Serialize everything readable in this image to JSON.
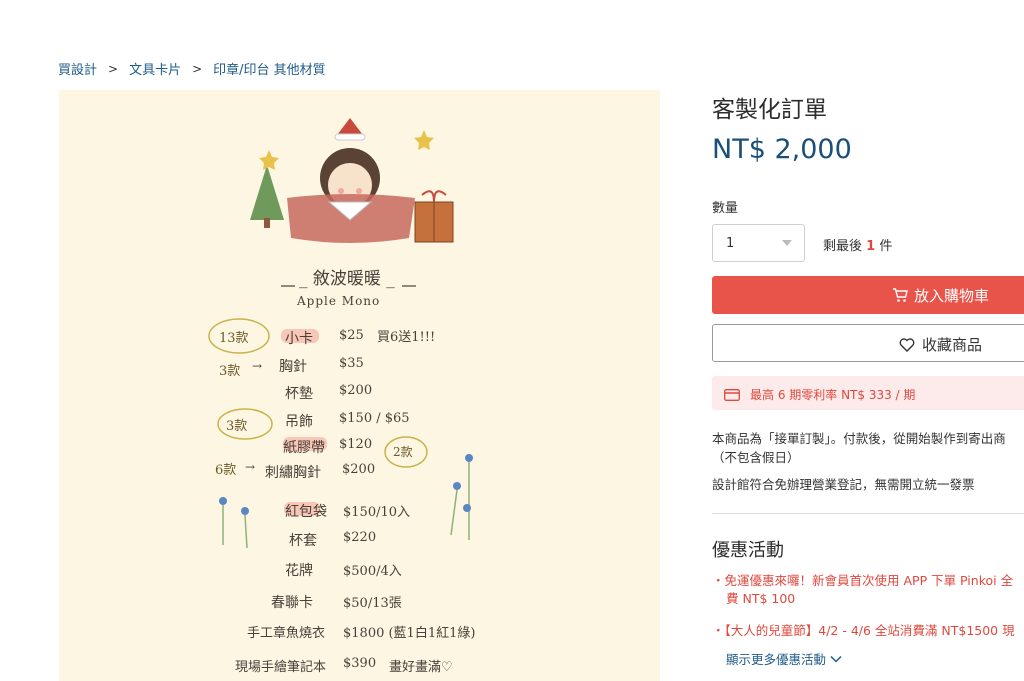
{
  "breadcrumb": {
    "items": [
      "買設計",
      "文具卡片",
      "印章/印台 其他材質"
    ]
  },
  "product_image": {
    "handwriting": {
      "heading": "_ 敘波暖暖 _",
      "subheading": "Apple Mono",
      "notes": {
        "n13": "13款",
        "n3a": "3款",
        "n3b": "3款",
        "n6": "6款",
        "n2": "2款",
        "arrow1": "→",
        "arrow2": "→"
      },
      "items": [
        {
          "name": "小卡",
          "price": "$25",
          "note": "買6送1!!!"
        },
        {
          "name": "胸針",
          "price": "$35",
          "note": ""
        },
        {
          "name": "杯墊",
          "price": "$200",
          "note": ""
        },
        {
          "name": "吊飾",
          "price": "$150 / $65",
          "note": ""
        },
        {
          "name": "紙膠帶",
          "price": "$120",
          "note": ""
        },
        {
          "name": "刺繡胸針",
          "price": "$200",
          "note": ""
        },
        {
          "name": "紅包袋",
          "price": "$150/10入",
          "note": ""
        },
        {
          "name": "杯套",
          "price": "$220",
          "note": ""
        },
        {
          "name": "花牌",
          "price": "$500/4入",
          "note": ""
        },
        {
          "name": "春聯卡",
          "price": "$50/13張",
          "note": ""
        },
        {
          "name": "手工章魚燒衣",
          "price": "$1800 (藍1白1紅1綠)",
          "note": ""
        },
        {
          "name": "現場手繪筆記本",
          "price": "$390",
          "note": "畫好畫滿♡"
        }
      ]
    }
  },
  "product": {
    "title": "客製化訂單",
    "price": "NT$ 2,000",
    "quantity_label": "數量",
    "quantity_value": "1",
    "stock_prefix": "剩最後",
    "stock_count": "1",
    "stock_suffix": "件",
    "add_to_cart": "放入購物車",
    "favorite": "收藏商品",
    "installment": "最高 6 期零利率 NT$ 333 / 期",
    "desc_line1": "本商品為「接單訂製」。付款後，從開始製作到寄出商",
    "desc_line2": "（不包含假日）",
    "desc_line3": "設計館符合免辦理營業登記，無需開立統一發票"
  },
  "promotions": {
    "title": "優惠活動",
    "items": [
      {
        "line1": "・免運優惠來囉！新會員首次使用 APP 下單 Pinkoi 全",
        "line2": "費 NT$ 100"
      },
      {
        "line1": "・【大人的兒童節】4/2 - 4/6 全站消費滿 NT$1500 現"
      }
    ],
    "more": "顯示更多優惠活動"
  },
  "colors": {
    "accent_red": "#e8534a",
    "price_blue": "#1b4f7a",
    "link_blue": "#1f5b8a",
    "image_bg": "#fdf6e3"
  },
  "icons": [
    "chevron-right-icon",
    "cart-icon",
    "heart-icon",
    "credit-card-icon",
    "chevron-down-icon",
    "caret-down-icon"
  ]
}
